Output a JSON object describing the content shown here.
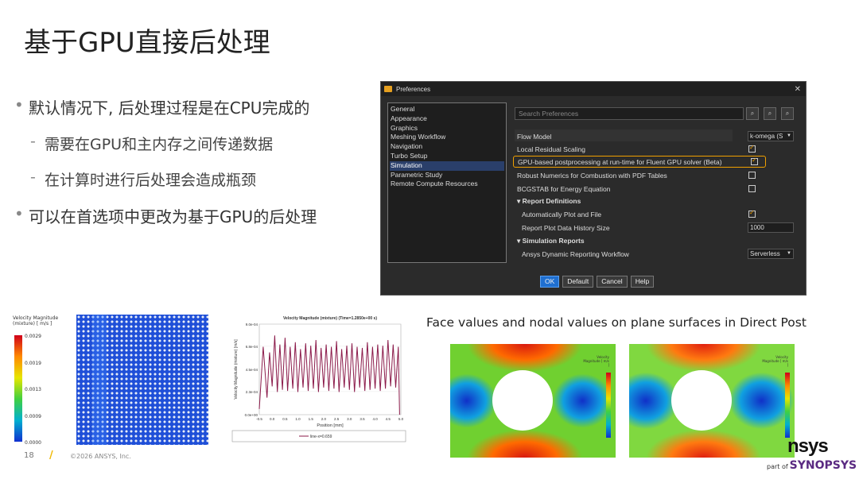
{
  "title": "基于GPU直接后处理",
  "bullets": {
    "b1": "默认情况下, 后处理过程是在CPU完成的",
    "b1a": "需要在GPU和主内存之间传递数据",
    "b1b": "在计算时进行后处理会造成瓶颈",
    "b2": "可以在首选项中更改为基于GPU的后处理"
  },
  "dialog": {
    "title": "Preferences",
    "close": "✕",
    "nav": [
      "General",
      "Appearance",
      "Graphics",
      "Meshing Workflow",
      "Navigation",
      "Turbo Setup",
      "Simulation",
      "Parametric Study",
      "Remote Compute Resources"
    ],
    "nav_selected": "Simulation",
    "search_placeholder": "Search Preferences",
    "rows": {
      "flow_model": "Flow Model",
      "flow_model_value": "k-omega (S",
      "local_residual": "Local Residual Scaling",
      "gpu_post": "GPU-based postprocessing at run-time for Fluent GPU solver (Beta)",
      "robust": "Robust Numerics for Combustion with PDF Tables",
      "bcgstab": "BCGSTAB for Energy Equation",
      "report_defs": "Report Definitions",
      "auto_plot": "Automatically Plot and File",
      "history_size": "Report Plot Data History Size",
      "history_value": "1000",
      "sim_reports": "Simulation Reports",
      "dyn_report": "Ansys Dynamic Reporting Workflow",
      "dyn_value": "Serverless"
    },
    "buttons": {
      "ok": "OK",
      "default": "Default",
      "cancel": "Cancel",
      "help": "Help"
    }
  },
  "contour": {
    "legend_title": "Velocity Magnitude (mixture) [ m/s ]",
    "ticks": [
      "0.0029",
      "0.0019",
      "0.0013",
      "0.0009",
      "0.0000"
    ]
  },
  "chart_data": {
    "type": "line",
    "title": "Velocity Magnitude (mixture) (Time=1.2850e+00 s)",
    "xlabel": "Position [mm]",
    "ylabel": "Velocity Magnitude (mixture) [m/s]",
    "xlim": [
      -0.5,
      5.0
    ],
    "ylim": [
      0,
      0.0008
    ],
    "x_ticks": [
      "-0.5",
      "0.0",
      "0.5",
      "1.0",
      "1.5",
      "2.0",
      "2.5",
      "3.0",
      "3.5",
      "4.0",
      "4.5",
      "5.0"
    ],
    "y_ticks": [
      "0.0e+00",
      "2.3e-04",
      "4.5e-04",
      "6.8e-04",
      "9.0e-04"
    ],
    "legend": "line-x=0.659",
    "series_color": "#8b1a4a",
    "series": [
      {
        "name": "line-x=0.659",
        "x": [
          -0.5,
          -0.35,
          -0.2,
          -0.1,
          0.0,
          0.1,
          0.2,
          0.3,
          0.4,
          0.5,
          0.6,
          0.7,
          0.8,
          0.9,
          1.0,
          1.1,
          1.2,
          1.3,
          1.4,
          1.5,
          1.6,
          1.7,
          1.8,
          1.9,
          2.0,
          2.1,
          2.2,
          2.3,
          2.4,
          2.5,
          2.6,
          2.7,
          2.8,
          2.9,
          3.0,
          3.1,
          3.2,
          3.3,
          3.4,
          3.5,
          3.6,
          3.7,
          3.8,
          3.9,
          4.0,
          4.1,
          4.2,
          4.3,
          4.4,
          4.5,
          4.6,
          4.7,
          4.8,
          4.9,
          4.95
        ],
        "y": [
          5e-05,
          0.0006,
          0.00015,
          0.00055,
          0.00025,
          0.0007,
          0.0002,
          0.00062,
          0.00022,
          0.00068,
          0.00021,
          0.0006,
          0.00023,
          0.00064,
          0.0002,
          0.00058,
          0.00024,
          0.00063,
          0.00021,
          0.00061,
          0.00023,
          0.00066,
          0.0002,
          0.00059,
          0.00024,
          0.00062,
          0.00021,
          0.0006,
          0.00023,
          0.00065,
          0.0002,
          0.00058,
          0.00024,
          0.00061,
          0.00022,
          0.00063,
          0.0002,
          0.0006,
          0.00024,
          0.00059,
          0.00021,
          0.00064,
          0.00022,
          0.0006,
          0.00023,
          0.00062,
          0.00021,
          0.00061,
          0.00023,
          0.00066,
          0.00025,
          0.00062,
          0.00024,
          0.0006,
          0.0
        ]
      }
    ]
  },
  "face_caption": "Face values and nodal values on plane surfaces in Direct Post",
  "face_legend_title": "Velocity Magnitude [ m/s ]",
  "footer": {
    "page": "18",
    "copyright": "©2026 ANSYS, Inc.",
    "logo_text": "nsys",
    "partof": "part of",
    "synopsys": "SYNOPSYS"
  }
}
